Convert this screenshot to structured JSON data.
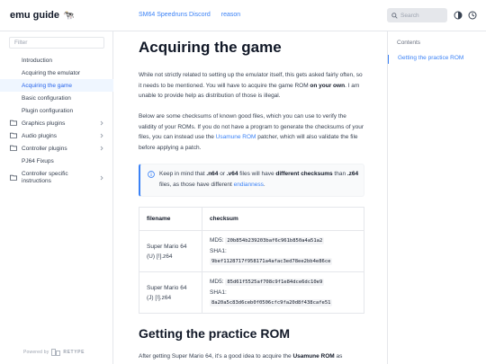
{
  "header": {
    "brand": "emu guide",
    "links": [
      "SM64 Speedruns Discord",
      "reason"
    ],
    "search_placeholder": "Search"
  },
  "sidebar": {
    "filter_placeholder": "Filter",
    "items": [
      {
        "label": "Introduction"
      },
      {
        "label": "Acquiring the emulator"
      },
      {
        "label": "Acquiring the game"
      },
      {
        "label": "Basic configuration"
      },
      {
        "label": "Plugin configuration"
      },
      {
        "label": "Graphics plugins"
      },
      {
        "label": "Audio plugins"
      },
      {
        "label": "Controller plugins"
      },
      {
        "label": "PJ64 Fixups"
      },
      {
        "label": "Controller specific instructions"
      }
    ],
    "powered_by": "Powered by",
    "powered_brand": "RETYPE"
  },
  "main": {
    "title": "Acquiring the game",
    "p1": {
      "pre": "While not strictly related to setting up the emulator itself, this gets asked fairly often, so it needs to be mentioned. You will have to acquire the game ROM ",
      "bold": "on your own",
      "post": ". I am unable to provide help as distribution of those is illegal."
    },
    "p2": {
      "pre": "Below are some checksums of known good files, which you can use to verify the validity of your ROMs. If you do not have a program to generate the checksums of your files, you can instead use the ",
      "link": "Usamune ROM",
      "post": " patcher, which will also validate the file before applying a patch."
    },
    "callout": {
      "t1": "Keep in mind that ",
      "b1": ".n64",
      "t2": " or ",
      "b2": ".v64",
      "t3": " files will have ",
      "b3": "different checksums",
      "t4": " than ",
      "b4": ".z64",
      "t5": " files, as those have different ",
      "link": "endianness",
      "t6": "."
    },
    "table": {
      "headers": [
        "filename",
        "checksum"
      ],
      "rows": [
        {
          "filename": "Super Mario 64 (U) [!].z64",
          "md5_label": "MD5:",
          "md5": "20b854b239203baf6c961b850a4a51a2",
          "sha1_label": "SHA1:",
          "sha1": "9bef1128717f958171a4afac3ed78ee2bb4e86ce"
        },
        {
          "filename": "Super Mario 64 (J) [!].z64",
          "md5_label": "MD5:",
          "md5": "85d61f5525af708c9f1e84dce6dc10e9",
          "sha1_label": "SHA1:",
          "sha1": "8a20a5c83d6ceb0f0506cfc9fa20d8f438cafe51"
        }
      ]
    },
    "subtitle": "Getting the practice ROM",
    "p3": {
      "pre": "After getting Super Mario 64, it's a good idea to acquire the ",
      "bold": "Usamune ROM",
      "post": " as"
    }
  },
  "toc": {
    "heading": "Contents",
    "items": [
      "Getting the practice ROM"
    ]
  },
  "colors": {
    "accent": "#3b82f6",
    "active_bg": "#eff6ff",
    "border": "#e5e7eb"
  }
}
